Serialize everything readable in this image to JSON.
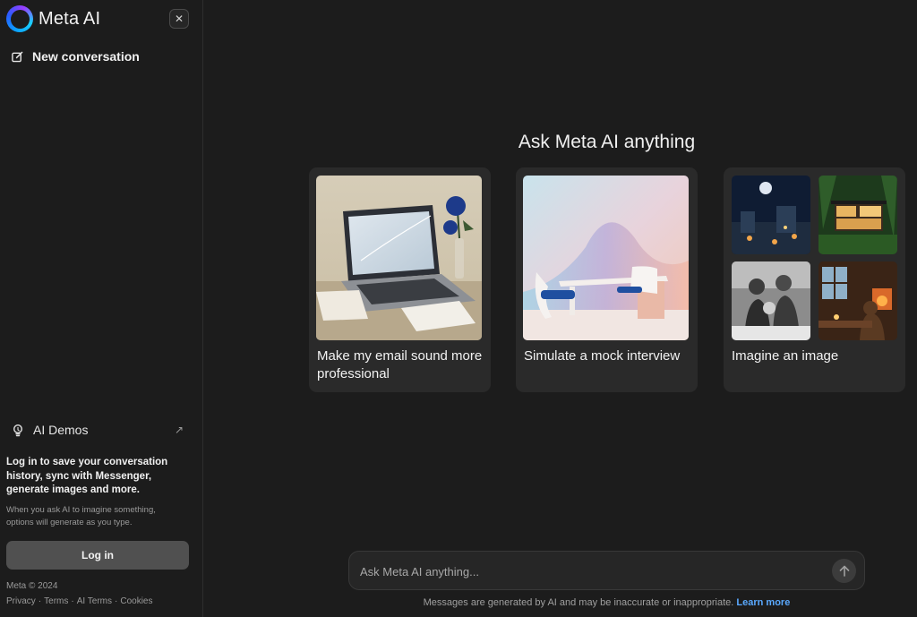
{
  "sidebar": {
    "brand": "Meta AI",
    "new_conversation": "New conversation",
    "ai_demos": "AI Demos",
    "login_title": "Log in to save your conversation history, sync with Messenger, generate images and more.",
    "login_subtitle": "When you ask AI to imagine something, options will generate as you type.",
    "login_button": "Log in",
    "copyright": "Meta © 2024",
    "footer_links": [
      "Privacy",
      "Terms",
      "AI Terms",
      "Cookies"
    ]
  },
  "main": {
    "heading": "Ask Meta AI anything",
    "cards": [
      {
        "label": "Make my email sound more professional"
      },
      {
        "label": "Simulate a mock interview"
      },
      {
        "label": "Imagine an image"
      }
    ],
    "composer": {
      "placeholder": "Ask Meta AI anything..."
    },
    "disclaimer": "Messages are generated by AI and may be inaccurate or inappropriate.",
    "learn_more": "Learn more"
  },
  "icons": {
    "brand": "meta-ai-ring-icon",
    "close": "close-icon",
    "new_conversation": "edit-icon",
    "ai_demos": "lightbulb-icon",
    "external": "arrow-up-right-icon",
    "send": "arrow-up-icon"
  }
}
